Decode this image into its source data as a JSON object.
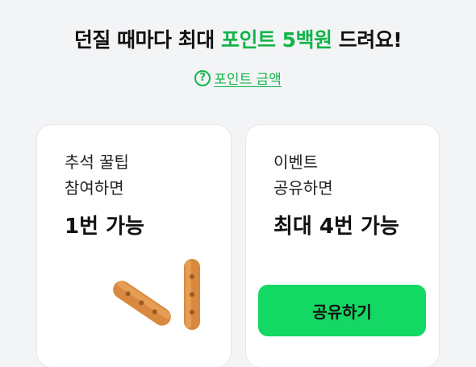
{
  "headline": {
    "part1": "던질 때마다 최대 ",
    "accent": "포인트 5백원",
    "part2": " 드려요!"
  },
  "help_link": {
    "icon": "question-circle-icon",
    "label": "포인트 금액"
  },
  "cards": [
    {
      "line1": "추석 꿀팁",
      "line2": "참여하면",
      "value": "1번 가능",
      "image": "snack-sticks"
    },
    {
      "line1": "이벤트",
      "line2": "공유하면",
      "value": "최대 4번 가능",
      "button_label": "공유하기"
    }
  ],
  "colors": {
    "accent": "#12b54a",
    "button": "#13d864",
    "background": "#f3f4f6"
  }
}
